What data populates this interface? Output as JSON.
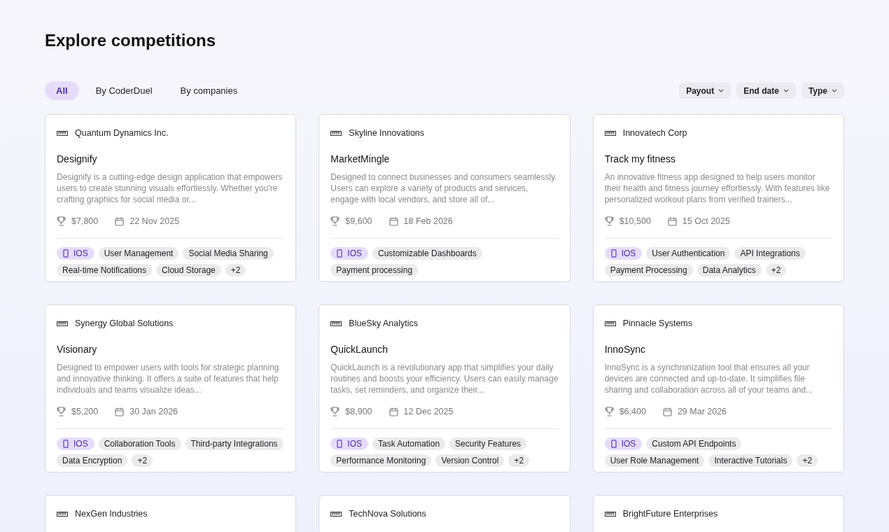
{
  "title": "Explore competitions",
  "tabs": [
    {
      "label": "All",
      "selected": true
    },
    {
      "label": "By CoderDuel",
      "selected": false
    },
    {
      "label": "By companies",
      "selected": false
    }
  ],
  "filters": [
    "Payout",
    "End date",
    "Type"
  ],
  "cards": [
    {
      "company": "Quantum Dynamics Inc.",
      "name": "Designify",
      "description": "Designify is a cutting-edge design application that empowers users to create stunning visuals effortlessly. Whether you're crafting graphics for social media or...",
      "payout": "$7,800",
      "end_date": "22 Nov 2025",
      "tags": [
        {
          "kind": "platform",
          "label": "IOS"
        },
        {
          "kind": "feature",
          "label": "User Management"
        },
        {
          "kind": "feature",
          "label": "Social Media Sharing"
        },
        {
          "kind": "feature",
          "label": "Real-time Notifications"
        },
        {
          "kind": "feature",
          "label": "Cloud Storage"
        },
        {
          "kind": "more",
          "label": "+2"
        }
      ]
    },
    {
      "company": "Skyline Innovations",
      "name": "MarketMingle",
      "description": "Designed to connect businesses and consumers seamlessly. Users can explore a variety of products and services, engage with local vendors, and store all of...",
      "payout": "$9,600",
      "end_date": "18 Feb 2026",
      "tags": [
        {
          "kind": "platform",
          "label": "IOS"
        },
        {
          "kind": "feature",
          "label": "Customizable Dashboards"
        },
        {
          "kind": "feature",
          "label": "Payment processing"
        }
      ]
    },
    {
      "company": "Innovatech Corp",
      "name": "Track my fitness",
      "description": "An innovative fitness app designed to help users monitor their health and fitness journey effortlessly. With features like personalized workout plans from verified trainers...",
      "payout": "$10,500",
      "end_date": "15 Oct 2025",
      "tags": [
        {
          "kind": "platform",
          "label": "IOS"
        },
        {
          "kind": "feature",
          "label": "User Authentication"
        },
        {
          "kind": "feature",
          "label": "API Integrations"
        },
        {
          "kind": "feature",
          "label": "Payment Processing"
        },
        {
          "kind": "feature",
          "label": "Data Analytics"
        },
        {
          "kind": "more",
          "label": "+2"
        }
      ]
    },
    {
      "company": "Synergy Global Solutions",
      "name": "Visionary",
      "description": "Designed to empower users with tools for strategic planning and innovative thinking. It offers a suite of features that help individuals and teams visualize ideas...",
      "payout": "$5,200",
      "end_date": "30 Jan 2026",
      "tags": [
        {
          "kind": "platform",
          "label": "IOS"
        },
        {
          "kind": "feature",
          "label": "Collaboration Tools"
        },
        {
          "kind": "feature",
          "label": "Third-party Integrations"
        },
        {
          "kind": "feature",
          "label": "Data Encryption"
        },
        {
          "kind": "more",
          "label": "+2"
        }
      ]
    },
    {
      "company": "BlueSky Analytics",
      "name": "QuickLaunch",
      "description": "QuickLaunch is a revolutionary app that simplifies your daily routines and boosts your efficiency. Users can easily manage tasks, set reminders, and organize their...",
      "payout": "$8,900",
      "end_date": "12 Dec 2025",
      "tags": [
        {
          "kind": "platform",
          "label": "IOS"
        },
        {
          "kind": "feature",
          "label": "Task Automation"
        },
        {
          "kind": "feature",
          "label": "Security Features"
        },
        {
          "kind": "feature",
          "label": "Performance Monitoring"
        },
        {
          "kind": "feature",
          "label": "Version Control"
        },
        {
          "kind": "more",
          "label": "+2"
        }
      ]
    },
    {
      "company": "Pinnacle Systems",
      "name": "InnoSync",
      "description": "InnoSync is a synchronization tool that ensures all your devices are connected and up-to-date. It simplifies file sharing and collaboration across all of your teams and...",
      "payout": "$6,400",
      "end_date": "29 Mar 2026",
      "tags": [
        {
          "kind": "platform",
          "label": "IOS"
        },
        {
          "kind": "feature",
          "label": "Custom API Endpoints"
        },
        {
          "kind": "feature",
          "label": "User Role Management"
        },
        {
          "kind": "feature",
          "label": "Interactive Tutorials"
        },
        {
          "kind": "more",
          "label": "+2"
        }
      ]
    },
    {
      "company": "NexGen Industries"
    },
    {
      "company": "TechNova Solutions"
    },
    {
      "company": "BrightFuture Enterprises"
    }
  ]
}
